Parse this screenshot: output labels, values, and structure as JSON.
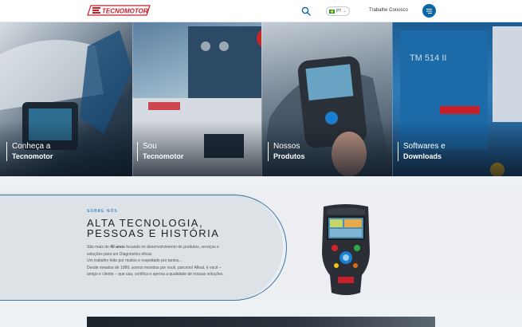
{
  "header": {
    "logo_text": "TECNOMOTOR",
    "search_icon": "search-icon",
    "language": {
      "selected": "PT",
      "flag": "brazil-flag-icon"
    },
    "work_link": "Trabalhe Conosco",
    "menu_icon": "menu-icon",
    "brand_color": "#c8202a",
    "accent_color": "#0b67a7"
  },
  "hero": {
    "panels": [
      {
        "line1": "Conheça a",
        "line2": "Tecnomotor"
      },
      {
        "line1": "Sou",
        "line2": "Tecnomotor"
      },
      {
        "line1": "Nossos",
        "line2": "Produtos"
      },
      {
        "line1": "Softwares e",
        "line2": "Downloads"
      }
    ]
  },
  "about": {
    "eyebrow": "SOBRE NÓS",
    "title_line1": "ALTA TECNOLOGIA,",
    "title_line2": "PESSOAS E HISTÓRIA",
    "para1_pre": "São mais de ",
    "para1_bold": "40 anos",
    "para1_post": " focando no desenvolvimento de produtos, serviços e soluções para um Diagnóstico eficaz.",
    "para2": "Um trabalho feito por muitos e respeitado por tantos...",
    "para3": "Desde meados de 1989, somos movidos por você, parceiro! Afinal, é você – amigo e cliente – que usa, certifica e aprova a qualidade de nossas soluções."
  }
}
